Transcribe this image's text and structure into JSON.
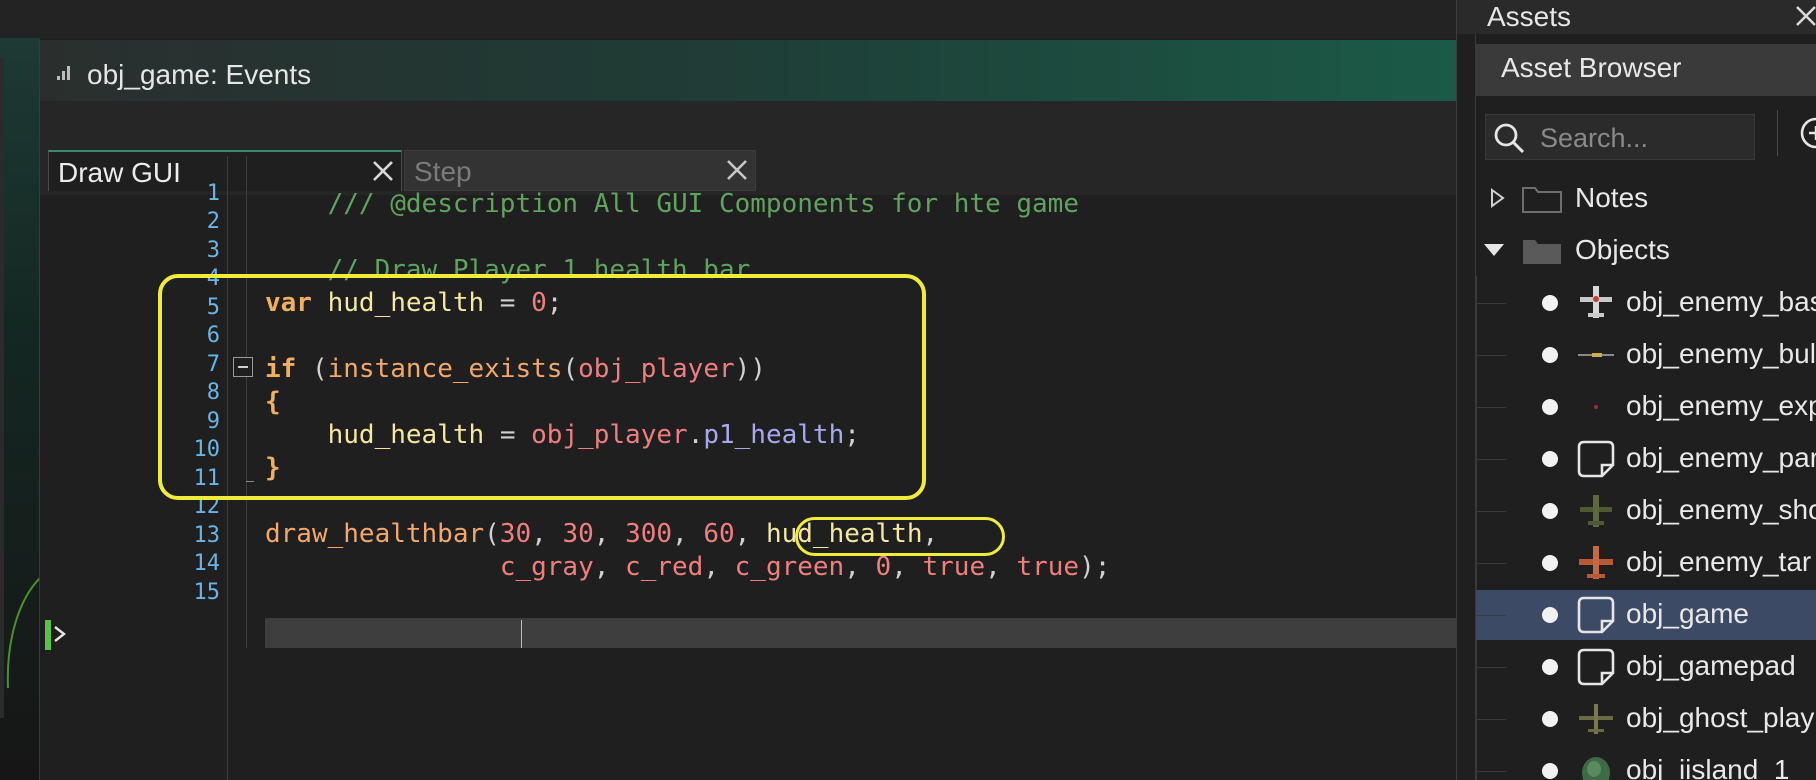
{
  "editor": {
    "title": "obj_game: Events",
    "tabs": [
      {
        "label": "Draw GUI"
      },
      {
        "label": "Step"
      }
    ],
    "line_numbers": [
      "1",
      "2",
      "3",
      "4",
      "5",
      "6",
      "7",
      "8",
      "9",
      "10",
      "11",
      "12",
      "13",
      "14",
      "15"
    ],
    "code": {
      "l1_comment": "/// @description All GUI Components for hte game",
      "l3_comment": "// Draw Player 1 health bar",
      "l5_kw": "var",
      "l5_var": " hud_health",
      "l5_eq": " = ",
      "l5_num": "0",
      "l5_semi": ";",
      "l7_kw": "if",
      "l7_open": " (",
      "l7_fn": "instance_exists",
      "l7_paren": "(",
      "l7_obj": "obj_player",
      "l7_close": "))",
      "l8_brace": "{",
      "l9_indent": "    ",
      "l9_var": "hud_health",
      "l9_eq": " = ",
      "l9_obj": "obj_player",
      "l9_dot": ".",
      "l9_prop": "p1_health",
      "l9_semi": ";",
      "l10_brace": "}",
      "l12_fn": "draw_healthbar",
      "l12_open": "(",
      "l12_a1": "30",
      "l12_c1": ", ",
      "l12_a2": "30",
      "l12_c2": ", ",
      "l12_a3": "300",
      "l12_c3": ", ",
      "l12_a4": "60",
      "l12_c4": ", ",
      "l12_var": "hud_health",
      "l12_c5": ",",
      "l13_indent": "               ",
      "l13_a1": "c_gray",
      "l13_c1": ", ",
      "l13_a2": "c_red",
      "l13_c2": ", ",
      "l13_a3": "c_green",
      "l13_c3": ", ",
      "l13_a4": "0",
      "l13_c4": ", ",
      "l13_a5": "true",
      "l13_c5": ", ",
      "l13_a6": "true",
      "l13_end": ");"
    }
  },
  "assets": {
    "title": "Assets",
    "browser_tab": "Asset Browser",
    "search_placeholder": "Search...",
    "folders": [
      {
        "label": "Notes",
        "expanded": false
      },
      {
        "label": "Objects",
        "expanded": true
      }
    ],
    "objects": [
      {
        "label": "obj_enemy_bas",
        "icon": "plane-sprite-icon",
        "selected": false
      },
      {
        "label": "obj_enemy_bul",
        "icon": "bullet-sprite-icon",
        "selected": false
      },
      {
        "label": "obj_enemy_exp",
        "icon": "explosion-sprite-icon",
        "selected": false
      },
      {
        "label": "obj_enemy_par",
        "icon": "object-icon",
        "selected": false
      },
      {
        "label": "obj_enemy_sho",
        "icon": "plane-sprite-icon",
        "selected": false
      },
      {
        "label": "obj_enemy_tar",
        "icon": "plane-sprite-icon",
        "selected": false
      },
      {
        "label": "obj_game",
        "icon": "object-icon",
        "selected": true
      },
      {
        "label": "obj_gamepad",
        "icon": "object-icon",
        "selected": false
      },
      {
        "label": "obj_ghost_play",
        "icon": "plane-sprite-icon",
        "selected": false
      },
      {
        "label": "obj_iisland_1",
        "icon": "island-sprite-icon",
        "selected": false
      }
    ]
  },
  "colors": {
    "highlight": "#f0ec3a",
    "selection": "#3c4a66",
    "accent_green": "#2f8c6c"
  }
}
